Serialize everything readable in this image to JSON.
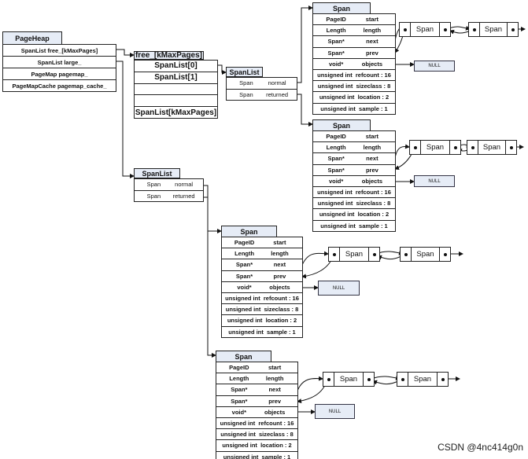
{
  "pageheap": {
    "title": "PageHeap",
    "fields": [
      "SpanList free_[kMaxPages]",
      "SpanList large_",
      "PageMap pagemap_",
      "PageMapCache pagemap_cache_"
    ]
  },
  "free_array": {
    "title": "free_[kMaxPages]",
    "items": [
      "SpanList[0]",
      "SpanList[1]",
      "",
      "",
      "SpanList[kMaxPages]"
    ]
  },
  "spanlist": {
    "title": "SpanList",
    "rows": [
      [
        "Span",
        "normal"
      ],
      [
        "Span",
        "returned"
      ]
    ]
  },
  "span_struct": {
    "title": "Span",
    "rows": [
      [
        "PageID",
        "start"
      ],
      [
        "Length",
        "length"
      ],
      [
        "Span*",
        "next"
      ],
      [
        "Span*",
        "prev"
      ],
      [
        "void*",
        "objects"
      ],
      [
        "unsigned int  refcount : 16"
      ],
      [
        "unsigned int  sizeclass : 8"
      ],
      [
        "unsigned int  location : 2"
      ],
      [
        "unsigned int  sample : 1"
      ]
    ]
  },
  "list_node": {
    "label": "Span"
  },
  "null_label": "NULL",
  "watermark": "CSDN @4nc414g0n"
}
